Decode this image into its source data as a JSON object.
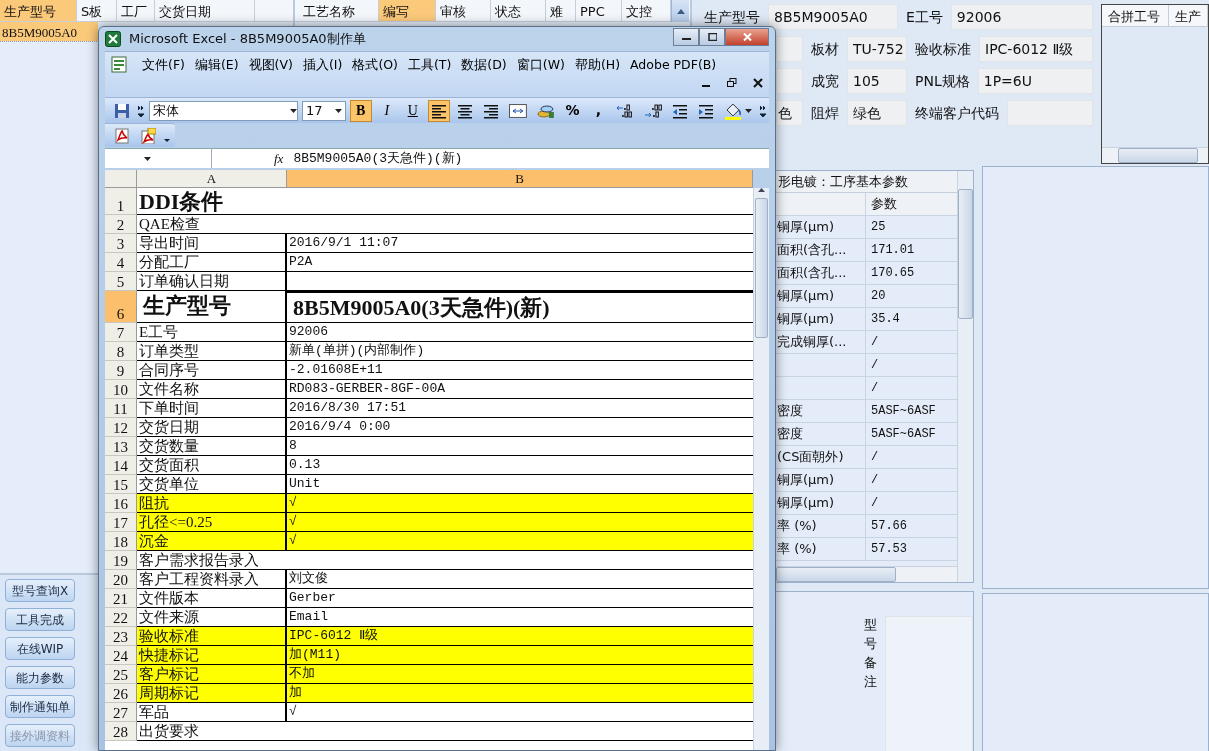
{
  "left_panel": {
    "columns": [
      {
        "label": "生产型号",
        "selected": true
      },
      {
        "label": "S板",
        "selected": false
      },
      {
        "label": "工厂",
        "selected": false
      },
      {
        "label": "交货日期",
        "selected": false
      }
    ],
    "rows": [
      {
        "model": "8B5M9005A0",
        "selected": true
      }
    ],
    "buttons": [
      {
        "label": "型号查询X",
        "disabled": false
      },
      {
        "label": "工具完成",
        "disabled": false
      },
      {
        "label": "在线WIP",
        "disabled": false
      },
      {
        "label": "能力参数",
        "disabled": false
      },
      {
        "label": "制作通知单",
        "disabled": false
      },
      {
        "label": "接外调资料",
        "disabled": true
      }
    ]
  },
  "process_panel": {
    "columns": [
      {
        "label": "工艺名称",
        "selected": false
      },
      {
        "label": "编写",
        "selected": true
      },
      {
        "label": "审核",
        "selected": false
      },
      {
        "label": "状态",
        "selected": false
      },
      {
        "label": "难",
        "selected": false
      },
      {
        "label": "PPC",
        "selected": false
      },
      {
        "label": "文控",
        "selected": false
      }
    ]
  },
  "form": [
    {
      "kind": "full",
      "pairs": [
        {
          "label": "生产型号",
          "value": "8B5M9005A0"
        },
        {
          "label": "E工号",
          "value": "92006"
        }
      ]
    },
    {
      "kind": "partial",
      "pairs": [
        {
          "label": "板材",
          "value": "TU-752"
        },
        {
          "label": "验收标准",
          "value": "IPC-6012 Ⅱ级"
        }
      ]
    },
    {
      "kind": "partial",
      "pairs": [
        {
          "label": "成宽",
          "value": "105"
        },
        {
          "label": "PNL规格",
          "value": "1P=6U"
        }
      ]
    },
    {
      "kind": "partial",
      "lead": "色",
      "pairs": [
        {
          "label": "阻焊",
          "value": "绿色"
        },
        {
          "label": "终端客户代码"
        }
      ]
    }
  ],
  "merge_list": {
    "columns": [
      "合拼工号",
      "生产"
    ]
  },
  "param_table": {
    "title": "形电镀：工序基本参数",
    "header": "参数",
    "rows": [
      {
        "name": "铜厚(μm)",
        "value": "25"
      },
      {
        "name": "面积(含孔...",
        "value": "171.01"
      },
      {
        "name": "面积(含孔...",
        "value": "170.65"
      },
      {
        "name": "铜厚(μm)",
        "value": "20"
      },
      {
        "name": "铜厚(μm)",
        "value": "35.4"
      },
      {
        "name": "完成铜厚(...",
        "value": "/"
      },
      {
        "value": "/"
      },
      {
        "value": "/"
      },
      {
        "name": "密度",
        "value": "5ASF~6ASF"
      },
      {
        "name": "密度",
        "value": "5ASF~6ASF"
      },
      {
        "name": "(CS面朝外)",
        "value": "/"
      },
      {
        "name": "铜厚(μm)",
        "value": "/"
      },
      {
        "name": "铜厚(μm)",
        "value": "/"
      },
      {
        "name": "率 (%)",
        "value": "57.66"
      },
      {
        "name": "率 (%)",
        "value": "57.53"
      }
    ]
  },
  "remarks": {
    "label": "型号备注"
  },
  "excel": {
    "title": "Microsoft Excel - 8B5M9005A0制作单",
    "menu": [
      "文件(F)",
      "编辑(E)",
      "视图(V)",
      "插入(I)",
      "格式(O)",
      "工具(T)",
      "数据(D)",
      "窗口(W)",
      "帮助(H)",
      "Adobe PDF(B)"
    ],
    "font": "宋体",
    "font_size": "17",
    "style_buttons": [
      {
        "label": "B",
        "selected": true
      },
      {
        "label": "I",
        "selected": false
      },
      {
        "label": "U",
        "selected": false
      }
    ],
    "align_buttons": [
      {
        "kind": "left",
        "selected": true
      },
      {
        "kind": "center",
        "selected": false
      },
      {
        "kind": "right",
        "selected": false
      }
    ],
    "number_buttons": [
      "%",
      ","
    ],
    "formula_label": "fx",
    "formula": "8B5M9005A0(3天急件)(新)",
    "columns": [
      {
        "label": "A",
        "selected": false
      },
      {
        "label": "B",
        "selected": true
      }
    ],
    "rows": [
      {
        "number": "1",
        "kind": "title",
        "a": "DDI条件",
        "highlighted": false,
        "selected": false
      },
      {
        "number": "2",
        "kind": "merged",
        "a": "QAE检查",
        "highlighted": false,
        "selected": false
      },
      {
        "number": "3",
        "kind": "pair",
        "a": "导出时间",
        "b": "2016/9/1 11:07",
        "highlighted": false,
        "selected": false
      },
      {
        "number": "4",
        "kind": "pair",
        "a": "分配工厂",
        "b": "P2A",
        "highlighted": false,
        "selected": false
      },
      {
        "number": "5",
        "kind": "pair",
        "a": "订单确认日期",
        "highlighted": false,
        "selected": false
      },
      {
        "number": "6",
        "kind": "key",
        "a": "生产型号",
        "b": "8B5M9005A0(3天急件)(新)",
        "highlighted": false,
        "selected": true
      },
      {
        "number": "7",
        "kind": "pair",
        "a": "E工号",
        "b": "92006",
        "highlighted": false,
        "selected": false
      },
      {
        "number": "8",
        "kind": "pair",
        "a": "订单类型",
        "b": "新单(单拼)(内部制作)",
        "highlighted": false,
        "selected": false
      },
      {
        "number": "9",
        "kind": "pair",
        "a": "合同序号",
        "b": "-2.01608E+11",
        "highlighted": false,
        "selected": false
      },
      {
        "number": "10",
        "kind": "pair",
        "a": "文件名称",
        "b": "RD083-GERBER-8GF-00A",
        "highlighted": false,
        "selected": false
      },
      {
        "number": "11",
        "kind": "pair",
        "a": "下单时间",
        "b": "2016/8/30 17:51",
        "highlighted": false,
        "selected": false
      },
      {
        "number": "12",
        "kind": "pair",
        "a": "交货日期",
        "b": "2016/9/4 0:00",
        "highlighted": false,
        "selected": false
      },
      {
        "number": "13",
        "kind": "pair",
        "a": "交货数量",
        "b": "8",
        "highlighted": false,
        "selected": false
      },
      {
        "number": "14",
        "kind": "pair",
        "a": "交货面积",
        "b": "0.13",
        "highlighted": false,
        "selected": false
      },
      {
        "number": "15",
        "kind": "pair",
        "a": "交货单位",
        "b": "Unit",
        "highlighted": false,
        "selected": false
      },
      {
        "number": "16",
        "kind": "pair",
        "a": "阻抗",
        "b": "√",
        "highlighted": true,
        "selected": false
      },
      {
        "number": "17",
        "kind": "pair",
        "a": "孔径<=0.25",
        "b": "√",
        "highlighted": true,
        "selected": false
      },
      {
        "number": "18",
        "kind": "pair",
        "a": "沉金",
        "b": "√",
        "highlighted": true,
        "selected": false
      },
      {
        "number": "19",
        "kind": "merged",
        "a": "客户需求报告录入",
        "highlighted": false,
        "selected": false
      },
      {
        "number": "20",
        "kind": "pair",
        "a": "客户工程资料录入",
        "b": "刘文俊",
        "highlighted": false,
        "selected": false
      },
      {
        "number": "21",
        "kind": "pair",
        "a": "文件版本",
        "b": "Gerber",
        "highlighted": false,
        "selected": false
      },
      {
        "number": "22",
        "kind": "pair",
        "a": "文件来源",
        "b": "Email",
        "highlighted": false,
        "selected": false
      },
      {
        "number": "23",
        "kind": "pair",
        "a": "验收标准",
        "b": "IPC-6012 Ⅱ级",
        "highlighted": true,
        "selected": false
      },
      {
        "number": "24",
        "kind": "pair",
        "a": "快捷标记",
        "b": "加(M11)",
        "highlighted": true,
        "selected": false
      },
      {
        "number": "25",
        "kind": "pair",
        "a": "客户标记",
        "b": "不加",
        "highlighted": true,
        "selected": false
      },
      {
        "number": "26",
        "kind": "pair",
        "a": "周期标记",
        "b": "加",
        "highlighted": true,
        "selected": false
      },
      {
        "number": "27",
        "kind": "pair",
        "a": "军品",
        "b": "√",
        "highlighted": false,
        "selected": false
      },
      {
        "number": "28",
        "kind": "merged",
        "a": "出货要求",
        "highlighted": false,
        "selected": false
      }
    ]
  }
}
